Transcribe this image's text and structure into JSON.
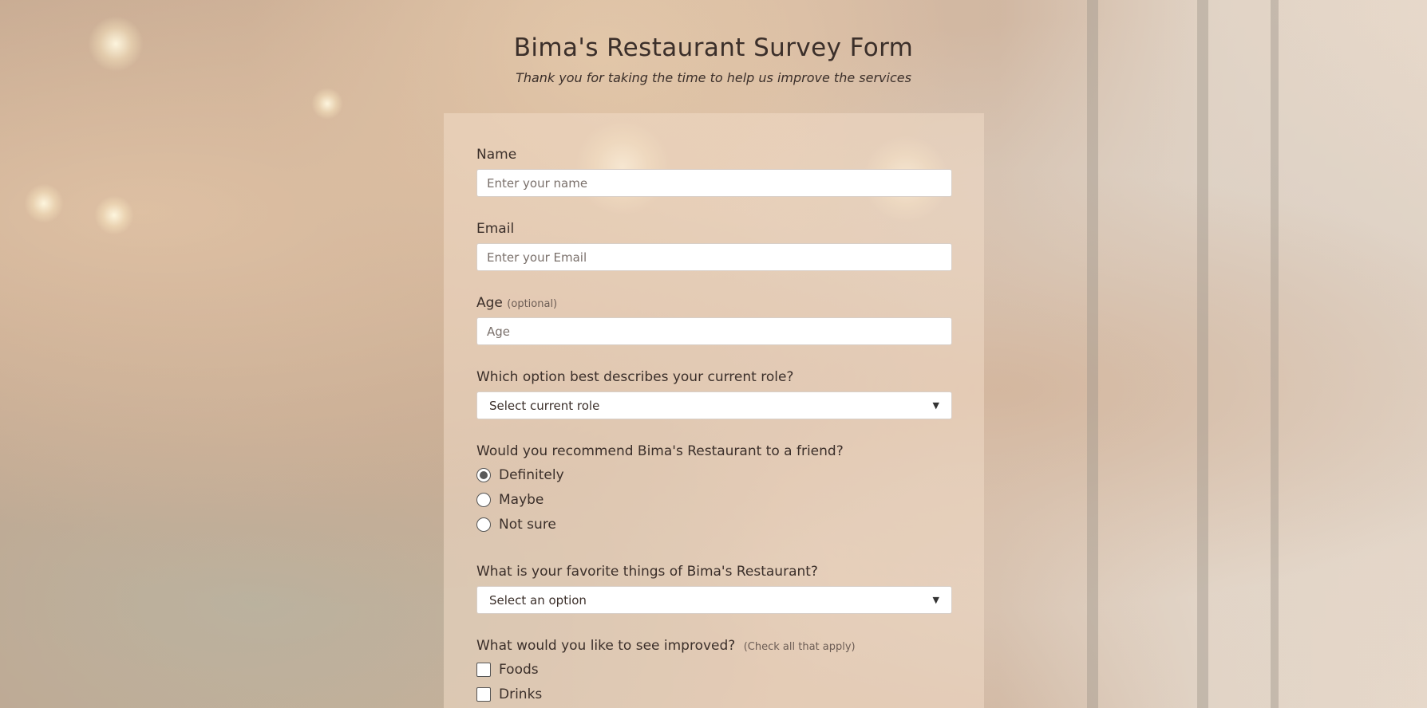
{
  "header": {
    "title": "Bima's Restaurant Survey Form",
    "subtitle": "Thank you for taking the time to help us improve the services"
  },
  "form": {
    "name": {
      "label": "Name",
      "placeholder": "Enter your name",
      "value": ""
    },
    "email": {
      "label": "Email",
      "placeholder": "Enter your Email",
      "value": ""
    },
    "age": {
      "label": "Age",
      "hint": "(optional)",
      "placeholder": "Age",
      "value": ""
    },
    "role": {
      "label": "Which option best describes your current role?",
      "selected": "Select current role"
    },
    "recommend": {
      "label": "Would you recommend Bima's Restaurant to a friend?",
      "options": [
        {
          "label": "Definitely",
          "checked": true
        },
        {
          "label": "Maybe",
          "checked": false
        },
        {
          "label": "Not sure",
          "checked": false
        }
      ]
    },
    "favorite": {
      "label": "What is your favorite things of Bima's Restaurant?",
      "selected": "Select an option"
    },
    "improve": {
      "label": "What would you like to see improved?",
      "hint": "(Check all that apply)",
      "options": [
        {
          "label": "Foods",
          "checked": false
        },
        {
          "label": "Drinks",
          "checked": false
        }
      ]
    }
  },
  "icons": {
    "select_chevron": "chevron-down-icon"
  }
}
